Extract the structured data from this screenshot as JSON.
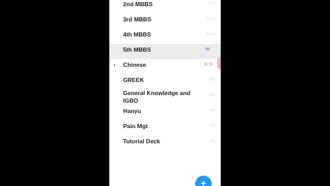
{
  "decks": [
    {
      "name": "2nd MBBS",
      "count": "23 0"
    },
    {
      "name": "3rd MBBS",
      "count": "0 1 4"
    },
    {
      "name": "4th MBBS",
      "count": "0 1 4"
    },
    {
      "name": "5th MBBS",
      "count": "89"
    },
    {
      "name": "Chinese",
      "count": "11 51"
    },
    {
      "name": "GREEK",
      "count": "0 0"
    },
    {
      "name": "General Knowledge and IGBO",
      "count": "0 0"
    },
    {
      "name": "Hanyu",
      "count": "0 0"
    },
    {
      "name": "Pain Mgt",
      "count": "0 0"
    },
    {
      "name": "Tutorial Deck",
      "count": "0 0"
    }
  ],
  "expander_glyph": "›",
  "fab_label": "+",
  "colors": {
    "selected_row": "#ececec",
    "fab": "#2196f3",
    "due_count_blue": "#5b5bd6"
  }
}
